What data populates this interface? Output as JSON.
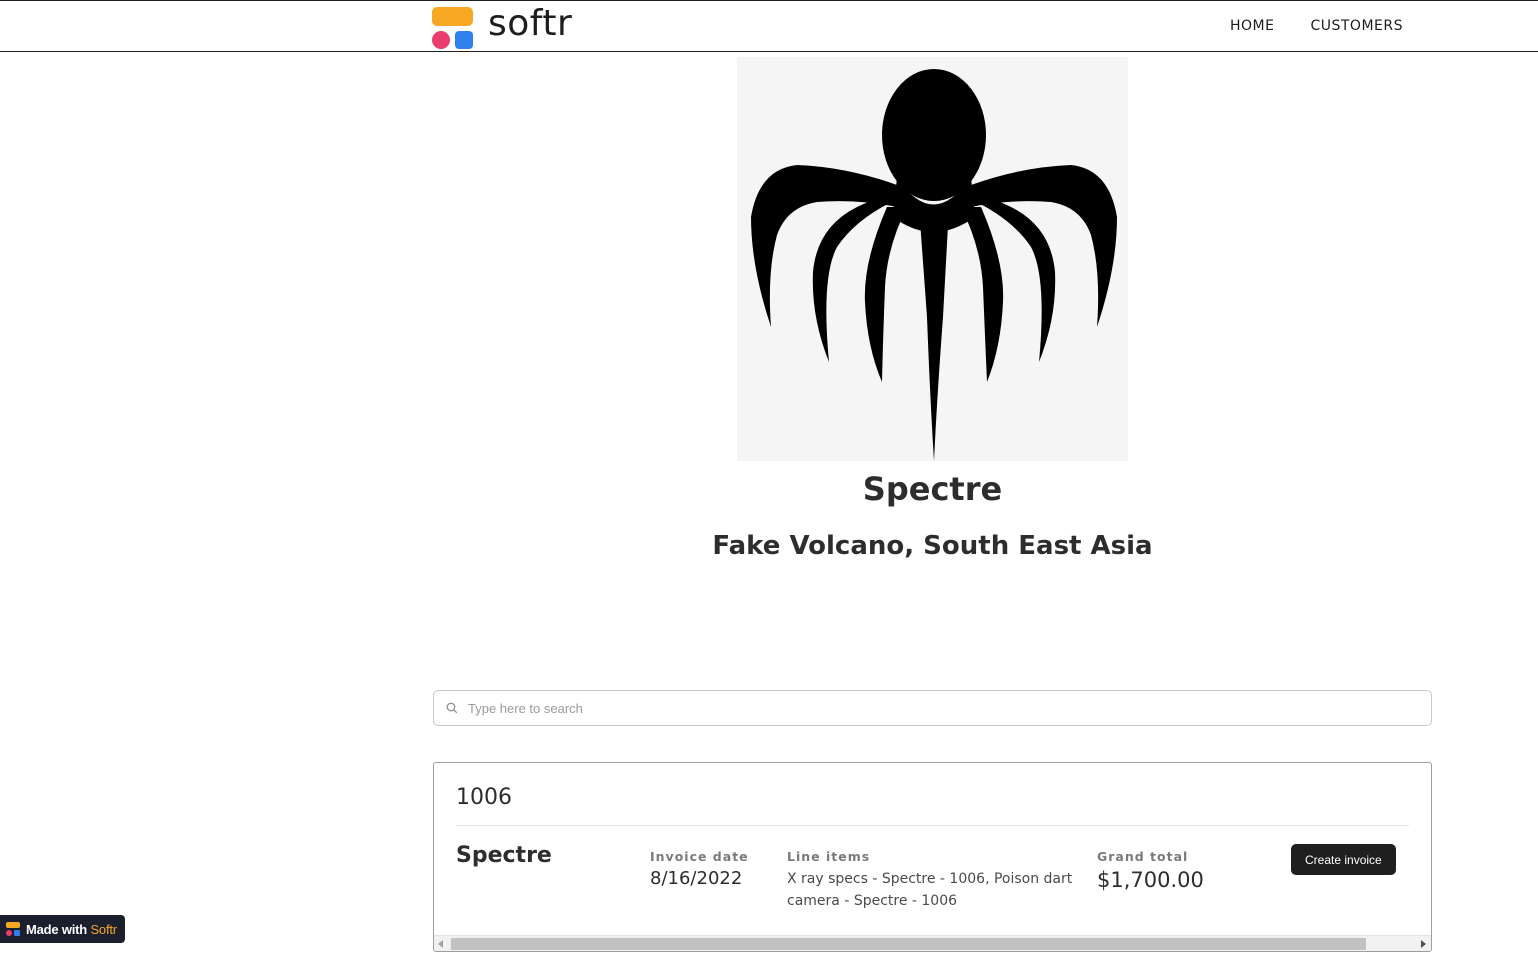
{
  "header": {
    "logo_text": "softr",
    "nav": [
      {
        "label": "HOME"
      },
      {
        "label": "CUSTOMERS"
      }
    ]
  },
  "profile": {
    "name": "Spectre",
    "location": "Fake Volcano, South East Asia"
  },
  "search": {
    "placeholder": "Type here to search"
  },
  "table": {
    "title": "1006",
    "row": {
      "name": "Spectre",
      "invoice_date_label": "Invoice date",
      "invoice_date": "8/16/2022",
      "line_items_label": "Line items",
      "line_items": "X ray specs - Spectre - 1006, Poison dart camera - Spectre - 1006",
      "grand_total_label": "Grand total",
      "grand_total": "$1,700.00",
      "button_label": "Create invoice"
    }
  },
  "badge": {
    "prefix": "Made with ",
    "brand": "Softr"
  },
  "colors": {
    "accent_orange": "#f6a823",
    "accent_pink": "#ea3d6b",
    "accent_blue": "#2f80ed",
    "button_dark": "#1f1f1f"
  }
}
